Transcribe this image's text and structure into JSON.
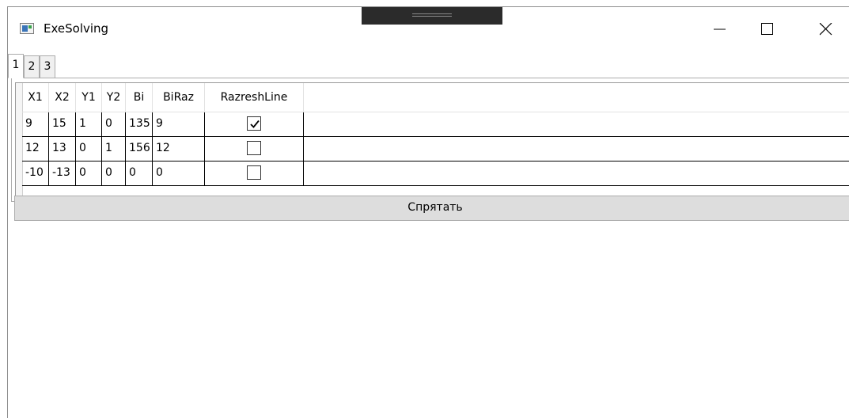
{
  "window": {
    "title": "ExeSolving",
    "controls": {
      "minimize": "minimize-icon",
      "maximize": "maximize-icon",
      "close": "close-icon"
    }
  },
  "tabs": [
    {
      "label": "1",
      "active": true
    },
    {
      "label": "2",
      "active": false
    },
    {
      "label": "3",
      "active": false
    }
  ],
  "grid": {
    "columns": [
      "X1",
      "X2",
      "Y1",
      "Y2",
      "Bi",
      "BiRaz",
      "RazreshLine"
    ],
    "rows": [
      {
        "x1": "9",
        "x2": "15",
        "y1": "1",
        "y2": "0",
        "bi": "135",
        "biraz": "9",
        "razreshline": true
      },
      {
        "x1": "12",
        "x2": "13",
        "y1": "0",
        "y2": "1",
        "bi": "156",
        "biraz": "12",
        "razreshline": false
      },
      {
        "x1": "-10",
        "x2": "-13",
        "y1": "0",
        "y2": "0",
        "bi": "0",
        "biraz": "0",
        "razreshline": false
      }
    ]
  },
  "hide_button": {
    "label": "Спрятать"
  }
}
